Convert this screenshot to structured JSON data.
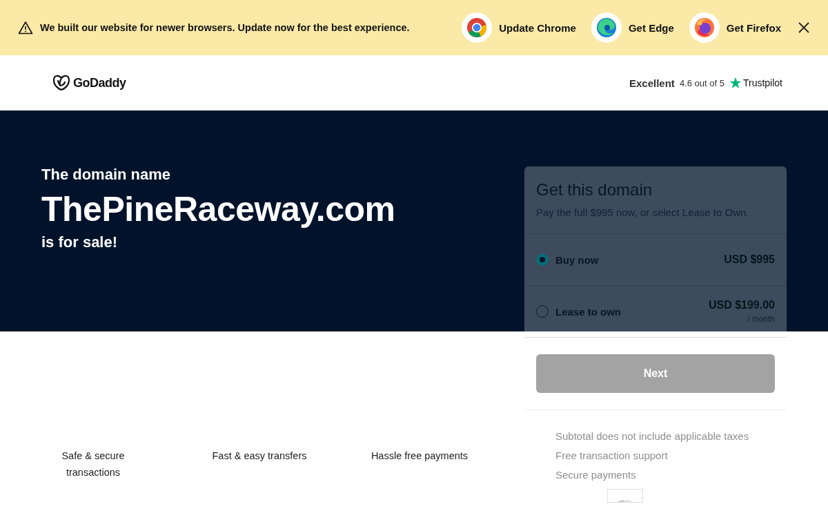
{
  "browser_banner": {
    "message": "We built our website for newer browsers. Update now for the best experience.",
    "browsers": [
      {
        "kind": "chrome",
        "label": "Update Chrome"
      },
      {
        "kind": "edge",
        "label": "Get Edge"
      },
      {
        "kind": "firefox",
        "label": "Get Firefox"
      }
    ]
  },
  "header": {
    "logo": "GoDaddy",
    "rating": {
      "word": "Excellent",
      "score": "4.6 out of 5",
      "brand": "Trustpilot"
    }
  },
  "hero": {
    "intro": "The domain name",
    "domain": "ThePineRaceway.com",
    "outro": "is for sale!"
  },
  "purchase_card": {
    "title": "Get this domain",
    "subtitle": "Pay the full $995 now, or select Lease to Own.",
    "options": [
      {
        "label": "Buy now",
        "price": "USD $995",
        "selected": true
      },
      {
        "label": "Lease to own",
        "price": "USD $199.00",
        "period": "/ month",
        "selected": false
      }
    ],
    "next_button": {
      "label": "Next",
      "disabled": true
    },
    "notes": [
      "Subtotal does not include applicable taxes",
      "Free transaction support",
      "Secure payments"
    ]
  },
  "features": [
    "Safe & secure transactions",
    "Fast & easy transfers",
    "Hassle free payments"
  ]
}
